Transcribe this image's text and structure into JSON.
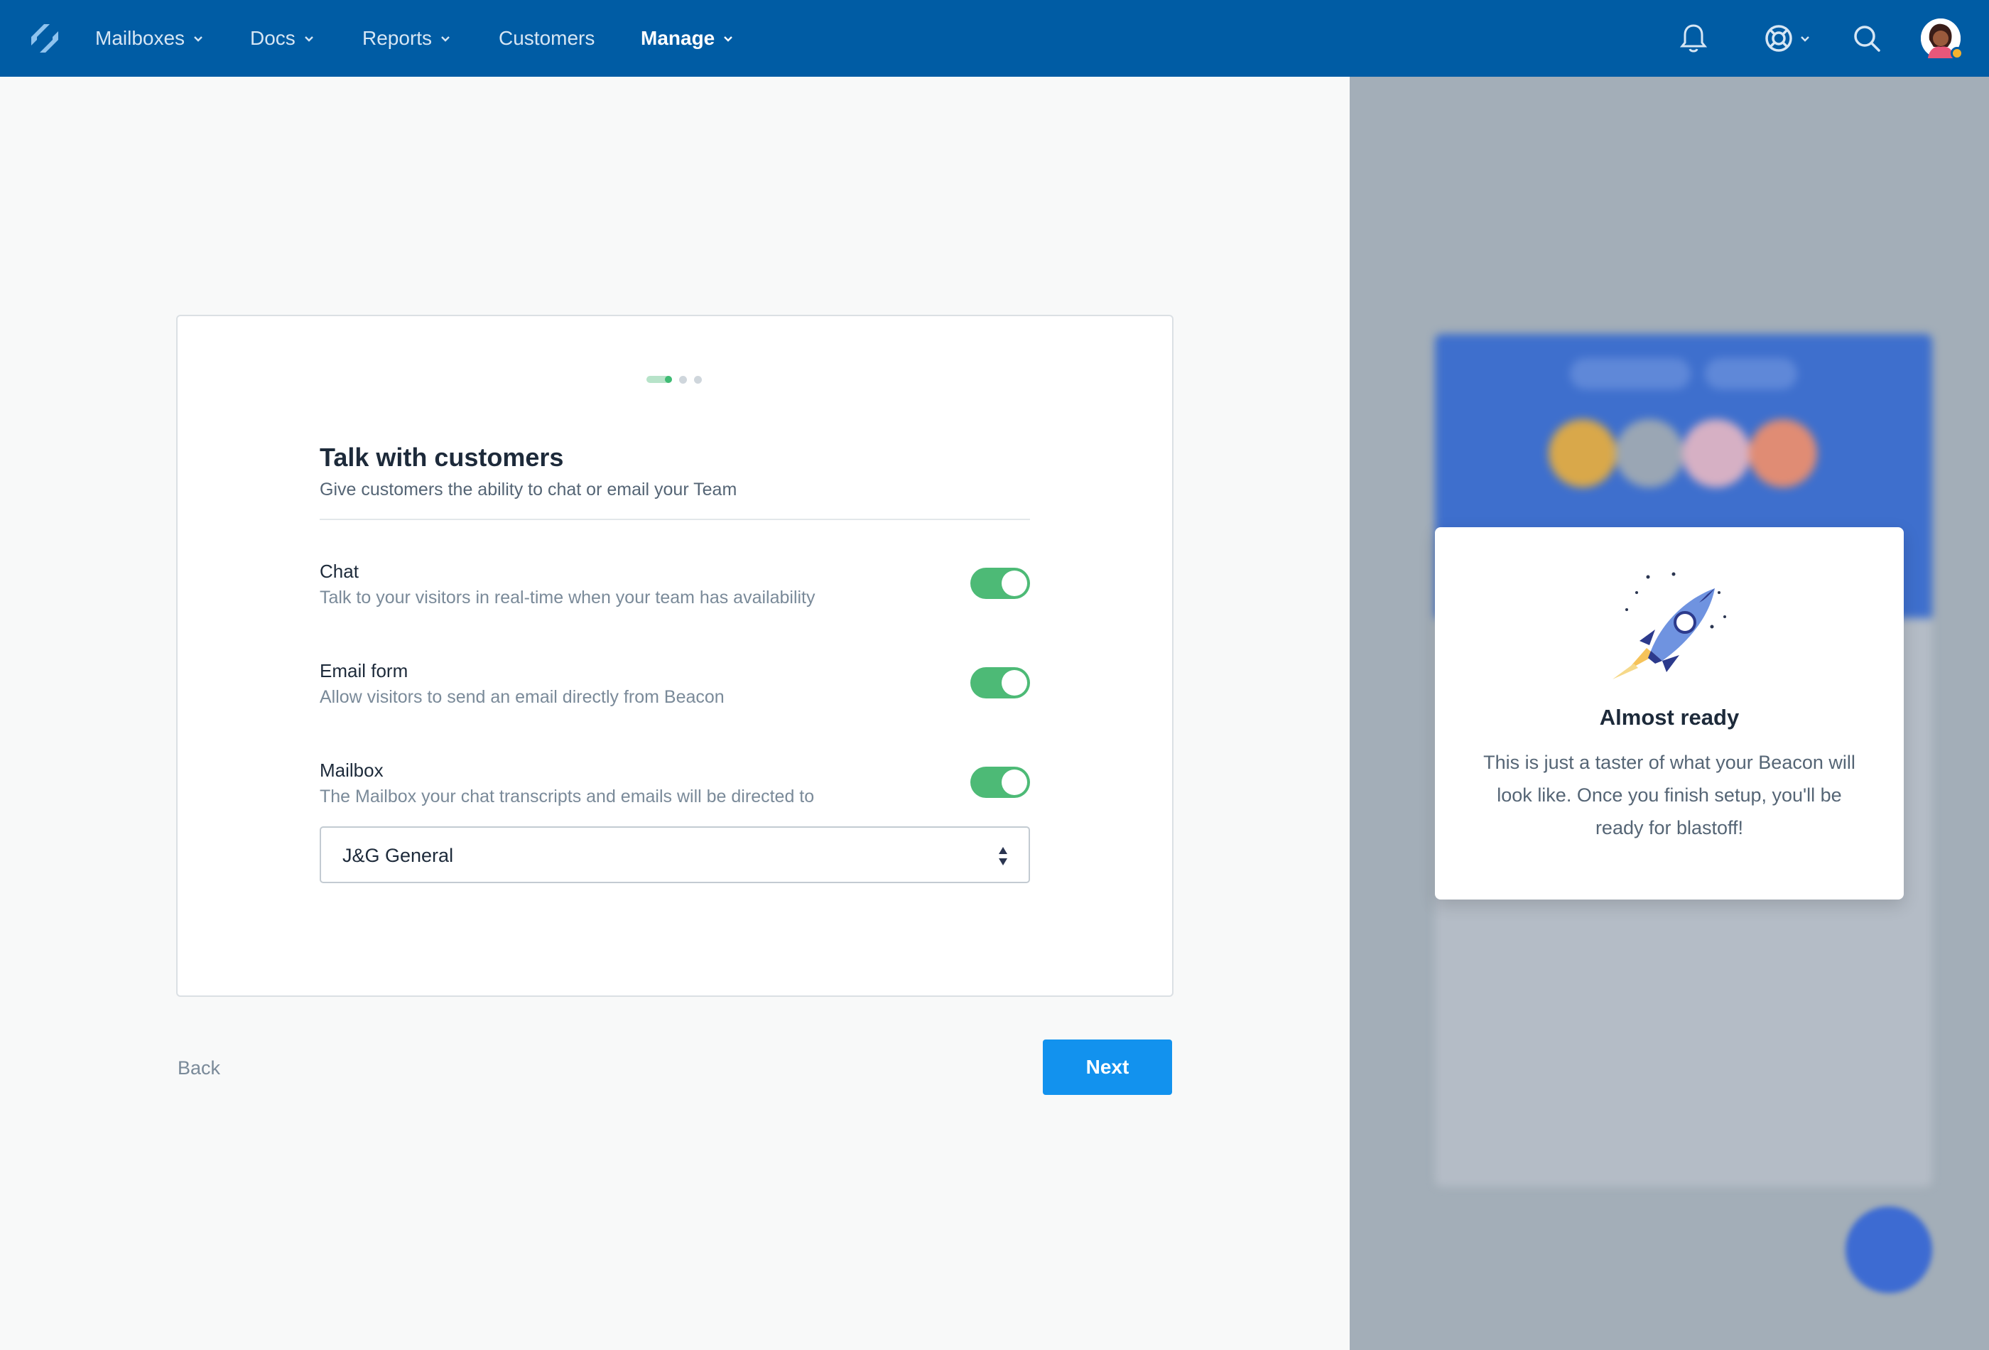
{
  "nav": {
    "items": [
      {
        "label": "Mailboxes",
        "has_dropdown": true
      },
      {
        "label": "Docs",
        "has_dropdown": true
      },
      {
        "label": "Reports",
        "has_dropdown": true
      },
      {
        "label": "Customers",
        "has_dropdown": false
      },
      {
        "label": "Manage",
        "has_dropdown": true,
        "active": true
      }
    ],
    "icons": [
      "bell-icon",
      "lifebuoy-icon",
      "search-icon"
    ],
    "brand_color": "#005ca4"
  },
  "wizard": {
    "steps_total": 4,
    "current_step": 1,
    "title": "Talk with customers",
    "subtitle": "Give customers the ability to chat or email your Team",
    "options": [
      {
        "label": "Chat",
        "description": "Talk to your visitors in real-time when your team has availability",
        "enabled": true
      },
      {
        "label": "Email form",
        "description": "Allow visitors to send an email directly from Beacon",
        "enabled": true
      },
      {
        "label": "Mailbox",
        "description": "The Mailbox your chat transcripts and emails will be directed to",
        "enabled": true
      }
    ],
    "mailbox_select": {
      "value": "J&G General"
    },
    "back_label": "Back",
    "next_label": "Next",
    "toggle_color": "#4dba76",
    "button_color": "#1292ee"
  },
  "preview": {
    "title": "Almost ready",
    "text": "This is just a taster of what your Beacon will look like. Once you finish setup, you'll be ready for blastoff!",
    "icon": "rocket-icon"
  }
}
